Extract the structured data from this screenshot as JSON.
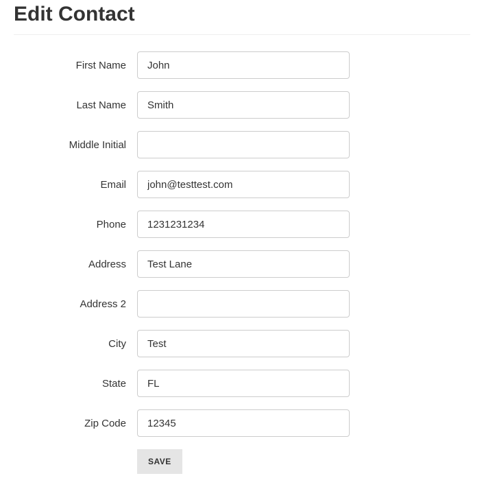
{
  "page": {
    "title": "Edit Contact"
  },
  "form": {
    "first_name": {
      "label": "First Name",
      "value": "John"
    },
    "last_name": {
      "label": "Last Name",
      "value": "Smith"
    },
    "middle_initial": {
      "label": "Middle Initial",
      "value": ""
    },
    "email": {
      "label": "Email",
      "value": "john@testtest.com"
    },
    "phone": {
      "label": "Phone",
      "value": "1231231234"
    },
    "address": {
      "label": "Address",
      "value": "Test Lane"
    },
    "address2": {
      "label": "Address 2",
      "value": ""
    },
    "city": {
      "label": "City",
      "value": "Test"
    },
    "state": {
      "label": "State",
      "value": "FL"
    },
    "zip": {
      "label": "Zip Code",
      "value": "12345"
    }
  },
  "actions": {
    "save": "SAVE"
  }
}
